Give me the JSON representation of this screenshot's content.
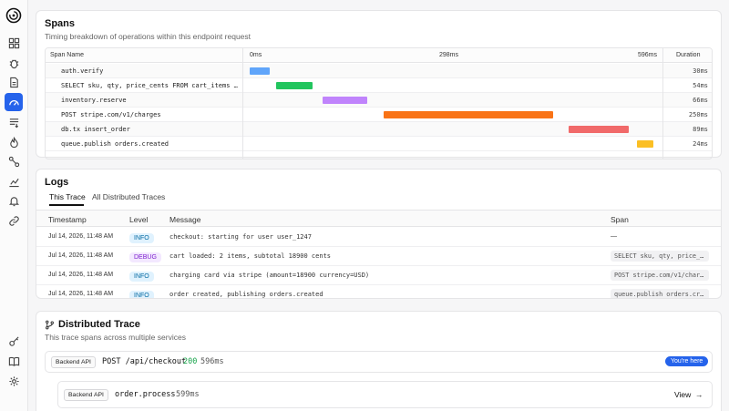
{
  "sidebar": {
    "icons": [
      "dashboard-icon",
      "bug-icon",
      "document-icon",
      "gauge-icon",
      "list-icon",
      "flame-icon",
      "nodes-icon",
      "chart-icon",
      "bell-icon",
      "link-icon",
      "key-icon",
      "book-icon",
      "gear-icon"
    ],
    "accent": "#2563eb"
  },
  "spans": {
    "title": "Spans",
    "subtitle": "Timing breakdown of operations within this endpoint request",
    "header": {
      "name": "Span Name",
      "t0": "0ms",
      "tmid": "298ms",
      "tmax": "596ms",
      "duration": "Duration"
    },
    "total_ms": 596,
    "rows": [
      {
        "name": "auth.verify",
        "start": 0,
        "duration_ms": 30,
        "duration": "30ms",
        "color": "#60a5fa"
      },
      {
        "name": "SELECT sku, qty, price_cents FROM cart_items WHE…",
        "start": 39,
        "duration_ms": 54,
        "duration": "54ms",
        "color": "#22c55e"
      },
      {
        "name": "inventory.reserve",
        "start": 107,
        "duration_ms": 66,
        "duration": "66ms",
        "color": "#c084fc"
      },
      {
        "name": "POST stripe.com/v1/charges",
        "start": 197,
        "duration_ms": 250,
        "duration": "250ms",
        "color": "#f97316"
      },
      {
        "name": "db.tx insert_order",
        "start": 470,
        "duration_ms": 89,
        "duration": "89ms",
        "color": "#f16a6a"
      },
      {
        "name": "queue.publish orders.created",
        "start": 570,
        "duration_ms": 24,
        "duration": "24ms",
        "color": "#fbbf24"
      }
    ]
  },
  "logs": {
    "title": "Logs",
    "tabs": [
      "This Trace",
      "All Distributed Traces"
    ],
    "columns": [
      "Timestamp",
      "Level",
      "Message",
      "Span"
    ],
    "rows": [
      {
        "timestamp": "Jul 14, 2026, 11:48 AM",
        "level": "INFO",
        "message": "checkout: starting for user user_1247",
        "span": "—"
      },
      {
        "timestamp": "Jul 14, 2026, 11:48 AM",
        "level": "DEBUG",
        "message": "cart loaded: 2 items, subtotal 18900 cents",
        "span": "SELECT sku, qty, price_c…"
      },
      {
        "timestamp": "Jul 14, 2026, 11:48 AM",
        "level": "INFO",
        "message": "charging card via stripe (amount=18900 currency=USD)",
        "span": "POST stripe.com/v1/charg…"
      },
      {
        "timestamp": "Jul 14, 2026, 11:48 AM",
        "level": "INFO",
        "message": "order created, publishing orders.created",
        "span": "queue.publish orders.cre…"
      }
    ]
  },
  "distributed": {
    "title": "Distributed Trace",
    "subtitle": "This trace spans across multiple services",
    "root": {
      "service": "Backend API",
      "method_path": "POST /api/checkout",
      "status": "200",
      "duration": "596ms",
      "badge": "You're here"
    },
    "child": {
      "service": "Backend API",
      "operation": "order.process",
      "duration": "599ms",
      "action": "View"
    }
  }
}
